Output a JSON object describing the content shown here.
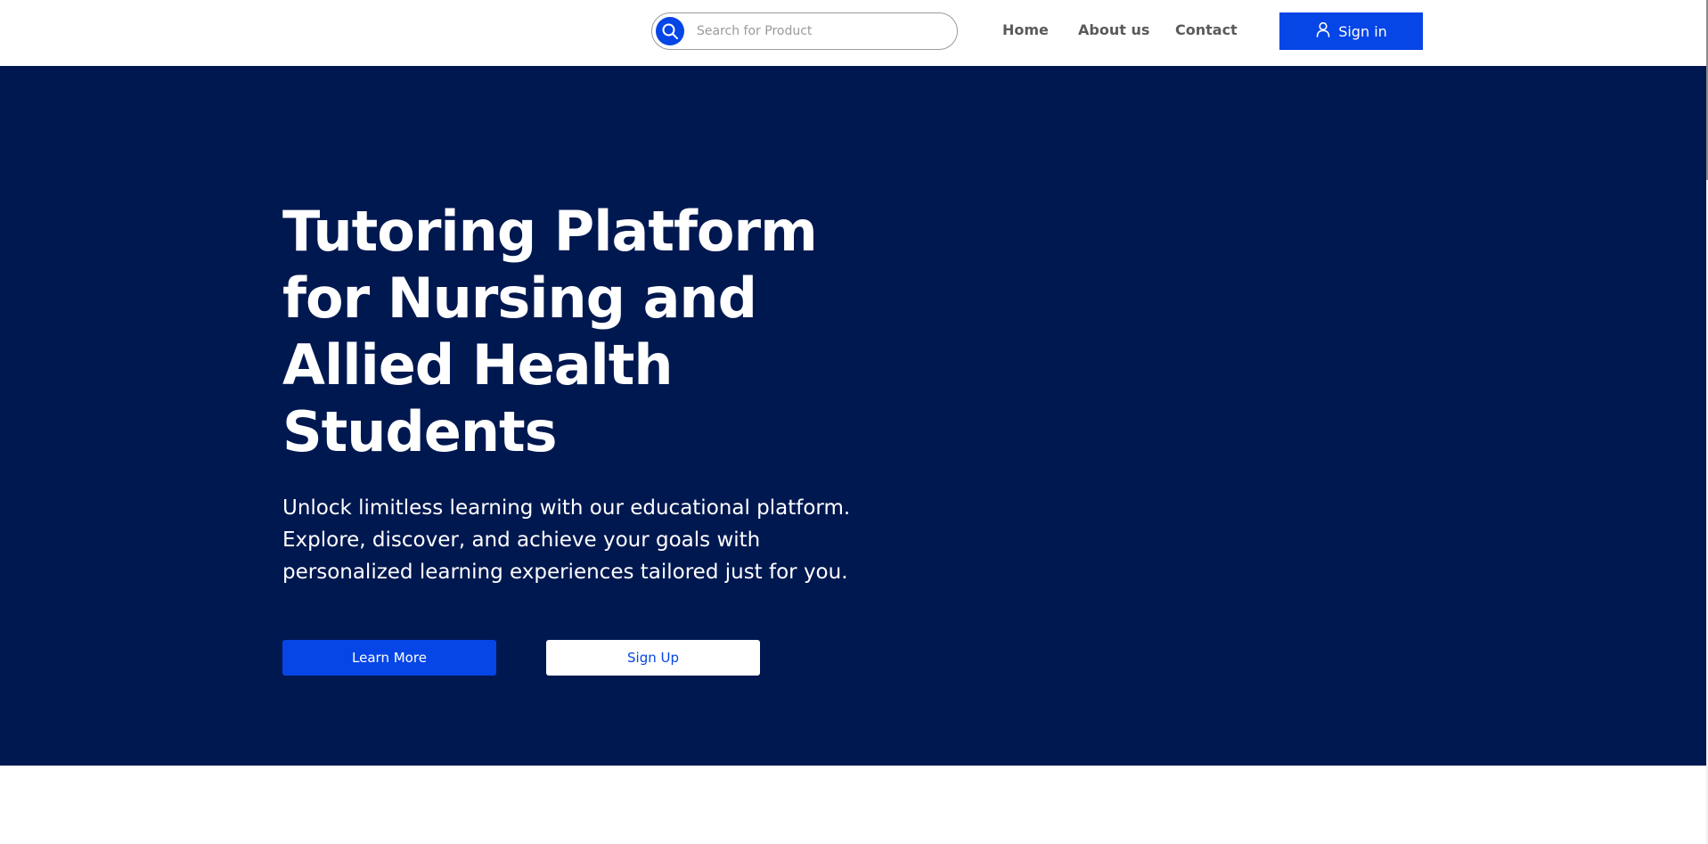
{
  "header": {
    "search": {
      "placeholder": "Search for Product",
      "icon": "search-icon"
    },
    "nav": {
      "home": "Home",
      "about": "About us",
      "contact": "Contact"
    },
    "signin": {
      "label": "Sign in",
      "icon": "user-icon"
    }
  },
  "hero": {
    "title": "Tutoring Platform for Nursing and Allied Health Students",
    "subtitle": "Unlock limitless learning with our educational platform. Explore, discover, and achieve your goals with personalized learning experiences tailored just for you.",
    "learn_more": "Learn More",
    "sign_up": "Sign Up"
  },
  "colors": {
    "hero_background": "#001850",
    "accent": "#0645e6",
    "nav_text": "#5a5a5a"
  }
}
